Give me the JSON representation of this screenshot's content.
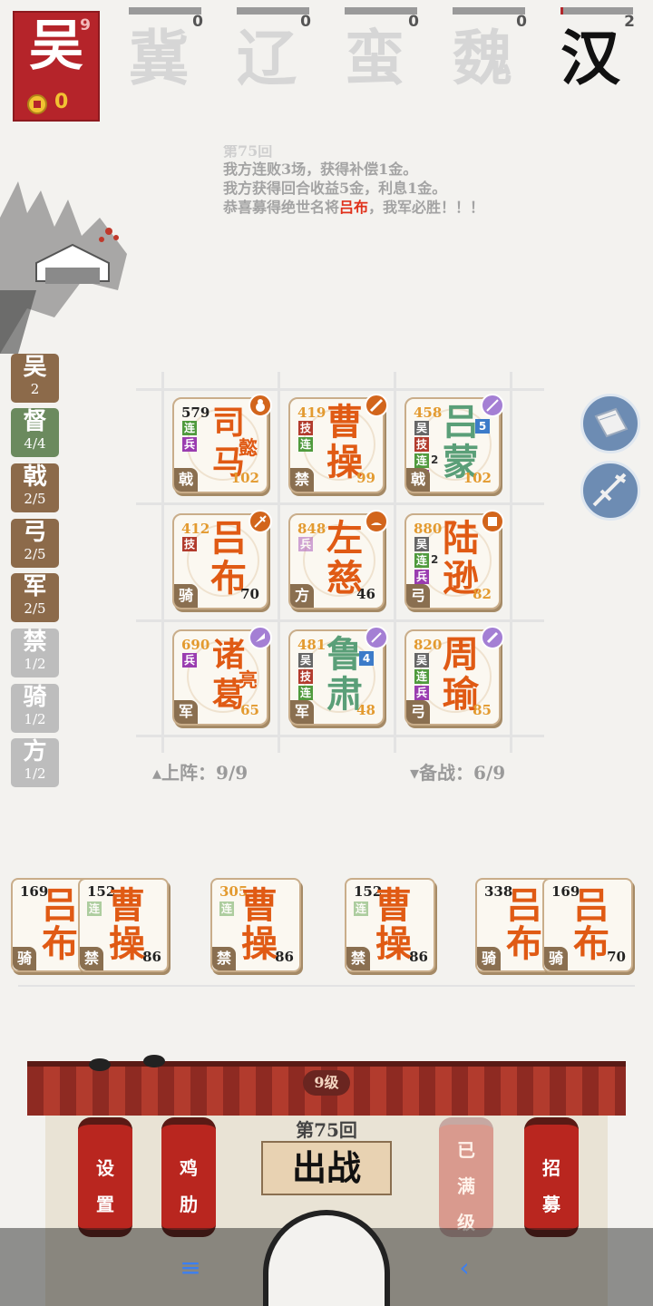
{
  "factions": [
    {
      "name": "吴",
      "count": "9",
      "gold": "0"
    },
    {
      "name": "冀",
      "count": "0"
    },
    {
      "name": "辽",
      "count": "0"
    },
    {
      "name": "蛮",
      "count": "0"
    },
    {
      "name": "魏",
      "count": "0"
    },
    {
      "name": "汉",
      "count": "2"
    }
  ],
  "log": {
    "line0": "第75回",
    "line1": "我方连败3场，获得补偿1金。",
    "line2": "我方获得回合收益5金，利息1金。",
    "line3_pre": "恭喜募得绝世名将",
    "line3_hl": "吕布",
    "line3_post": "，我军必胜！！！"
  },
  "troops": [
    {
      "t": "吴",
      "n": "2"
    },
    {
      "t": "督",
      "n": "4/4"
    },
    {
      "t": "戟",
      "n": "2/5"
    },
    {
      "t": "弓",
      "n": "2/5"
    },
    {
      "t": "军",
      "n": "2/5"
    },
    {
      "t": "禁",
      "n": "1/2"
    },
    {
      "t": "骑",
      "n": "1/2"
    },
    {
      "t": "方",
      "n": "1/2"
    }
  ],
  "board": [
    {
      "power": "579",
      "name": "司马",
      "sub": "懿",
      "lv": "102",
      "type": "戟",
      "badges": [
        "连",
        "兵"
      ]
    },
    {
      "power": "419",
      "name": "曹操",
      "lv": "99",
      "type": "禁",
      "badges": [
        "技",
        "连"
      ]
    },
    {
      "power": "458",
      "name": "吕蒙",
      "lv": "102",
      "type": "戟",
      "badges": [
        "吴",
        "技",
        "连",
        "兵"
      ],
      "extra": "5",
      "cnt": "2"
    },
    {
      "power": "412",
      "name": "吕布",
      "lv": "70",
      "type": "骑",
      "badges": [
        "技"
      ]
    },
    {
      "power": "848",
      "name": "左慈",
      "lv": "46",
      "type": "方",
      "badges": [
        "兵"
      ]
    },
    {
      "power": "880",
      "name": "陆逊",
      "lv": "82",
      "type": "弓",
      "badges": [
        "吴",
        "连",
        "兵"
      ],
      "cnt": "2"
    },
    {
      "power": "690",
      "name": "诸葛",
      "sub": "亮",
      "lv": "65",
      "type": "军",
      "badges": [
        "兵"
      ]
    },
    {
      "power": "481",
      "name": "鲁肃",
      "lv": "48",
      "type": "军",
      "badges": [
        "吴",
        "技",
        "连"
      ],
      "extra": "4"
    },
    {
      "power": "820",
      "name": "周瑜",
      "lv": "85",
      "type": "弓",
      "badges": [
        "吴",
        "连",
        "兵"
      ]
    }
  ],
  "status": {
    "on_field": "▴上阵：9/9",
    "reserve": "▾备战：6/9"
  },
  "bench": [
    {
      "power": "169",
      "name": "吕布",
      "type": "骑",
      "lv": ""
    },
    {
      "power": "152",
      "name": "曹操",
      "type": "禁",
      "lv": "86",
      "badge": "连"
    },
    {
      "power": "305",
      "name": "曹操",
      "type": "禁",
      "lv": "86",
      "badge": "连"
    },
    {
      "power": "152",
      "name": "曹操",
      "type": "禁",
      "lv": "86",
      "badge": "连"
    },
    {
      "power": "338",
      "name": "吕布",
      "type": "骑",
      "lv": ""
    },
    {
      "power": "169",
      "name": "吕布",
      "type": "骑",
      "lv": "70"
    }
  ],
  "footer": {
    "level": "9级",
    "round": "第75回",
    "fight": "出战",
    "settings": [
      "设",
      "置"
    ],
    "chicken": [
      "鸡",
      "肋"
    ],
    "full": [
      "已",
      "满",
      "级"
    ],
    "recruit": [
      "招",
      "募"
    ]
  },
  "nav": {
    "menu": "≡",
    "home": "▢",
    "back": "‹"
  }
}
